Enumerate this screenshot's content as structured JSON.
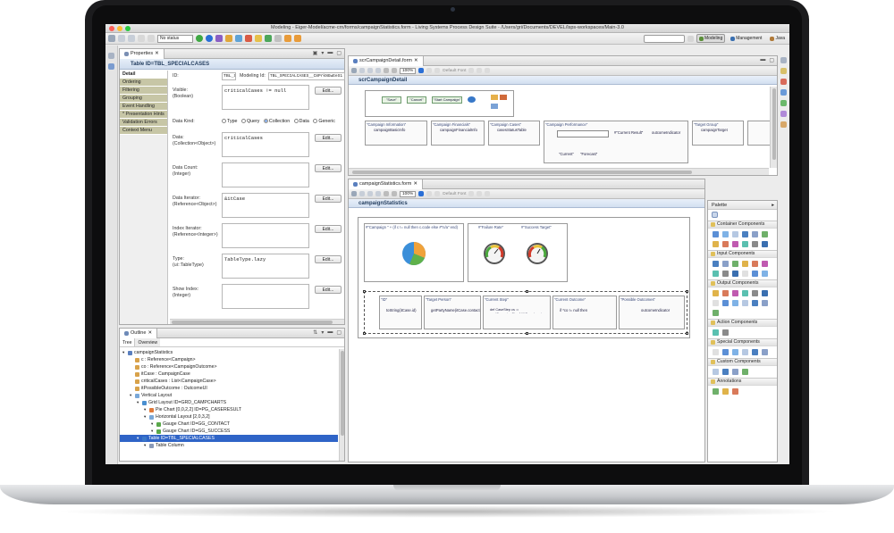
{
  "window": {
    "title": "Modeling - Eiger-Model/acme-crn/forms/campaignStatistics.form - Living Systems Process Design Suite - /Users/gri/Documents/DEVEL/lsps-workspaces/Main-3.0"
  },
  "toolbar": {
    "status_select": "No status",
    "perspectives": [
      {
        "label": "Modeling",
        "active": true
      },
      {
        "label": "Management",
        "active": false
      },
      {
        "label": "Java",
        "active": false
      }
    ]
  },
  "properties": {
    "tab_label": "Properties",
    "header": "Table ID=TBL_SPECIALCASES",
    "side_tabs": [
      "Detail",
      "Ordering",
      "Filtering",
      "Grouping",
      "Event Handling",
      "* Presentation Hints",
      "Validation Errors",
      "Context Menu"
    ],
    "id_label": "ID:",
    "id_value": "TBL_S",
    "modeling_id_label": "Modeling Id:",
    "modeling_id_value": "TBL_SPECIALCASES__C8PrkNGwEeS1",
    "fields": [
      {
        "label": "Visible:",
        "type": "(Boolean)",
        "value": "criticalCases != null",
        "edit": "Edit..."
      },
      {
        "label": "Data:",
        "type": "(Collection<Object>)",
        "value": "criticalCases",
        "edit": "Edit..."
      },
      {
        "label": "Data Count:",
        "type": "(Integer)",
        "value": "",
        "edit": "Edit..."
      },
      {
        "label": "Data Iterator:",
        "type": "(Reference<Object>)",
        "value": "&itCase",
        "edit": "Edit..."
      },
      {
        "label": "Index Iterator:",
        "type": "(Reference<Integer>)",
        "value": "",
        "edit": "Edit..."
      },
      {
        "label": "Type:",
        "type": "(ui::TableType)",
        "value": "TableType.lazy",
        "edit": "Edit..."
      },
      {
        "label": "Show Index:",
        "type": "(Integer)",
        "value": "",
        "edit": "Edit..."
      }
    ],
    "data_kind_label": "Data Kind:",
    "data_kind_options": [
      "Type",
      "Query",
      "Collection",
      "Data",
      "Generic"
    ],
    "data_kind_selected": "Collection"
  },
  "outline": {
    "tab_label": "Outline",
    "tabs": [
      "Tree",
      "Overview"
    ],
    "items": [
      {
        "label": "campaignStatistics",
        "depth": 0,
        "icon": "form-icon"
      },
      {
        "label": "c : Reference<Campaign>",
        "depth": 1,
        "icon": "variable-icon"
      },
      {
        "label": "co : Reference<CampaignOutcome>",
        "depth": 1,
        "icon": "variable-icon"
      },
      {
        "label": "itCase : CampaignCase",
        "depth": 1,
        "icon": "variable-icon"
      },
      {
        "label": "criticalCases : List<CampaignCase>",
        "depth": 1,
        "icon": "variable-icon"
      },
      {
        "label": "itPossibleOutcome : OutcomeUI",
        "depth": 1,
        "icon": "variable-icon"
      },
      {
        "label": "Vertical Layout",
        "depth": 1,
        "icon": "layout-icon"
      },
      {
        "label": "Grid Layout ID=GRD_CAMPCHARTS",
        "depth": 2,
        "icon": "grid-icon"
      },
      {
        "label": "Pie Chart [0,0,2,2] ID=PG_CASERESULT",
        "depth": 3,
        "icon": "pie-icon"
      },
      {
        "label": "Horizontal Layout [2,0,3,2]",
        "depth": 3,
        "icon": "layout-icon"
      },
      {
        "label": "Gauge Chart ID=GG_CONTACT",
        "depth": 4,
        "icon": "gauge-icon"
      },
      {
        "label": "Gauge Chart ID=GG_SUCCESS",
        "depth": 4,
        "icon": "gauge-icon"
      },
      {
        "label": "Table ID=TBL_SPECIALCASES",
        "depth": 2,
        "icon": "table-icon",
        "selected": true
      },
      {
        "label": "Table Column",
        "depth": 3,
        "icon": "column-icon"
      }
    ]
  },
  "editor_top": {
    "tab_label": "scrCampaignDetail.form",
    "zoom": "100%",
    "font": "Default Font",
    "form_title": "scrCampaignDetail",
    "buttons": [
      "\"Save\"",
      "\"Cancel\"",
      "\"Start Campaign\""
    ],
    "columns": [
      {
        "header": "\"Campaign Information\"",
        "body": "campaignBasicInfo"
      },
      {
        "header": "\"Campaign Financials\"",
        "body": "campaignFinancialInfo"
      },
      {
        "header": "\"Campaign Cases\"",
        "body": "casesStatusTable"
      },
      {
        "header": "\"Campaign Performance\"",
        "body": "#\"Current Result\""
      },
      {
        "header": "\"Target Group\"",
        "body": "campaignTarget"
      }
    ],
    "outcome_indicator": "outcomeIndicator",
    "radio_current": "\"Current\"",
    "radio_forecast": "\"Forecast\""
  },
  "editor_bottom": {
    "tab_label": "campaignStatistics.form",
    "zoom": "100%",
    "font": "Default Font",
    "form_title": "campaignStatistics",
    "pie_label": "#\"Campaign \" + (if c != null then c.code else #\"n/a\" end)",
    "gauge_labels": [
      "#\"Failure Rate\"",
      "#\"Success Target\""
    ],
    "table_columns": [
      {
        "header": "\"ID\"",
        "body": "toString(itCase.id)"
      },
      {
        "header": "\"Target Person\"",
        "body": "getPartyName(itCase.contact)"
      },
      {
        "header": "\"Current Step\"",
        "body": "def CaseStep cs := nextCampaignStepAlt(*Search cs to build"
      },
      {
        "header": "\"Current Outcome\"",
        "body": "if *co != null then"
      },
      {
        "header": "\"Possible Outcomes\"",
        "body": "outcomeIndicator"
      }
    ]
  },
  "palette": {
    "title": "Palette",
    "sections": [
      {
        "label": "Container Components",
        "count": 12
      },
      {
        "label": "Input Components",
        "count": 12
      },
      {
        "label": "Output Components",
        "count": 13
      },
      {
        "label": "Action Components",
        "count": 2
      },
      {
        "label": "Special Components",
        "count": 6
      },
      {
        "label": "Custom Components",
        "count": 4
      },
      {
        "label": "Annotations",
        "count": 3
      }
    ]
  },
  "colors": {
    "accent": "#2a6fd6",
    "selection": "#2f64c7",
    "side_tab": "#c7c6a6",
    "gauge_red": "#d13a2a",
    "gauge_green": "#4aa83c"
  }
}
